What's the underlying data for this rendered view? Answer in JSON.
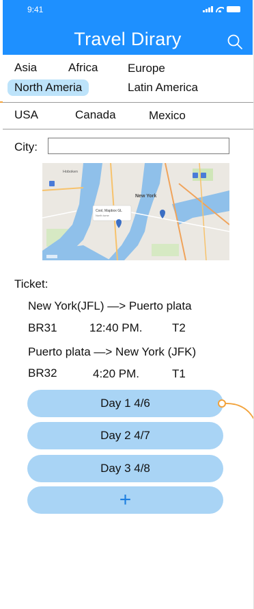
{
  "status": {
    "time": "9:41"
  },
  "header": {
    "title": "Travel Dirary"
  },
  "regions": {
    "asia": "Asia",
    "africa": "Africa",
    "europe": "Europe",
    "north_america": "North Ameria",
    "latin_america": "Latin America",
    "selected": "North Ameria"
  },
  "countries": [
    "USA",
    "Canada",
    "Mexico"
  ],
  "city": {
    "label": "City:",
    "value": "",
    "placeholder": ""
  },
  "map": {
    "labels": [
      "Hoboken",
      "New York",
      "Cool, Mapbox GL",
      "North tome"
    ]
  },
  "ticket": {
    "label": "Ticket:",
    "flights": [
      {
        "route": "New York(JFL)  —> Puerto plata",
        "code": "BR31",
        "time": "12:40 PM.",
        "terminal": "T2"
      },
      {
        "route": "Puerto plata  —> New York (JFK)",
        "code": "BR32",
        "time": "4:20  PM.",
        "terminal": "T1"
      }
    ]
  },
  "days": [
    "Day 1  4/6",
    "Day 2  4/7",
    "Day 3  4/8"
  ],
  "add_label": "+",
  "colors": {
    "primary": "#1e90ff",
    "pill": "#a9d4f5",
    "selected_region": "#bde3fa",
    "accent_connector": "#f2a23a",
    "add_icon": "#1e7fe0"
  },
  "icons": [
    "search-icon",
    "signal-icon",
    "wifi-icon",
    "battery-icon",
    "map-pin-icon",
    "add-icon"
  ]
}
